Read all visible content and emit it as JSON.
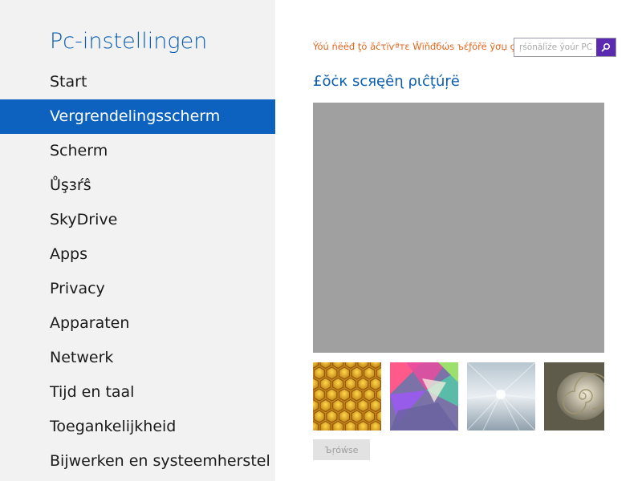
{
  "sidebar": {
    "title": "Pc-instellingen",
    "items": [
      {
        "label": "Start",
        "selected": false
      },
      {
        "label": "Vergrendelingsscherm",
        "selected": true
      },
      {
        "label": "Scherm",
        "selected": false
      },
      {
        "label": "Ůşзŕŝ",
        "selected": false
      },
      {
        "label": "SkyDrive",
        "selected": false
      },
      {
        "label": "Apps",
        "selected": false
      },
      {
        "label": "Privacy",
        "selected": false
      },
      {
        "label": "Apparaten",
        "selected": false
      },
      {
        "label": "Netwerk",
        "selected": false
      },
      {
        "label": "Tijd en taal",
        "selected": false
      },
      {
        "label": "Toegankelijkheid",
        "selected": false
      },
      {
        "label": "Bijwerken en systeemherstel",
        "selected": false
      }
    ]
  },
  "main": {
    "activation_message": "Ýóú ńëëđ ţŏ ăĉτїѵªтε Ŵїňđбώѕ ъέƒŏřë ўσџ çăn pё",
    "search": {
      "placeholder": "ŗśŏnăĺĭźe ŷoúr PC.",
      "icon": "search-icon"
    },
    "section_title": "£ŏċк scяęêɳ ρɩĉţúŗë",
    "preview_color": "#a0a0a0",
    "thumbnails": [
      {
        "name": "honeycomb"
      },
      {
        "name": "geometric"
      },
      {
        "name": "tunnel"
      },
      {
        "name": "nautilus-shell"
      }
    ],
    "browse_label": "Ъŗόẃѕe"
  }
}
